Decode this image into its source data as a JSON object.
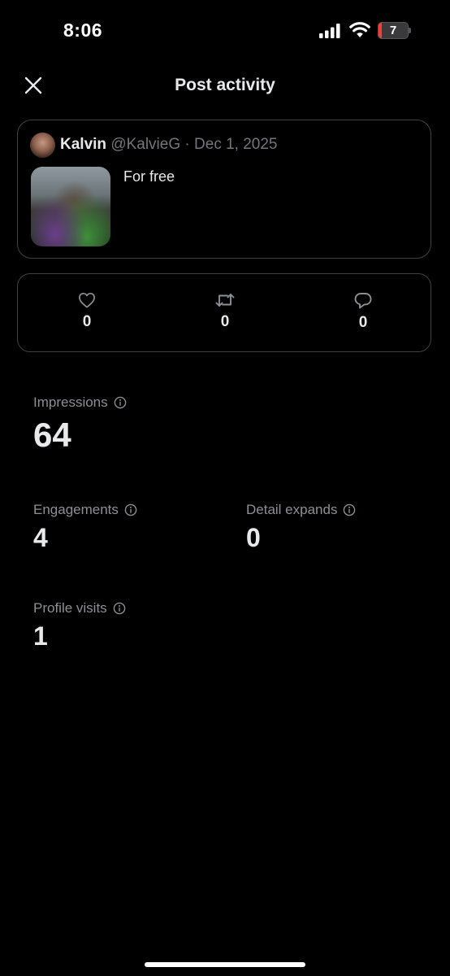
{
  "status_bar": {
    "time": "8:06",
    "battery_level": "7",
    "battery_fraction": 0.07
  },
  "header": {
    "title": "Post activity",
    "close_icon": "close-icon"
  },
  "post": {
    "author_name": "Kalvin",
    "handle": "@KalvieG",
    "separator": "·",
    "date": "Dec 1, 2025",
    "text": "For free"
  },
  "interactions": {
    "likes": "0",
    "reposts": "0",
    "replies": "0",
    "icons": [
      "heart-icon",
      "repost-icon",
      "reply-icon"
    ]
  },
  "stats": {
    "impressions": {
      "label": "Impressions",
      "value": "64"
    },
    "engagements": {
      "label": "Engagements",
      "value": "4"
    },
    "detail_expands": {
      "label": "Detail expands",
      "value": "0"
    },
    "profile_visits": {
      "label": "Profile visits",
      "value": "1"
    }
  },
  "colors": {
    "background": "#000000",
    "text_primary": "#e7e9ea",
    "text_secondary": "#71767b",
    "border": "#3e4144",
    "battery_low": "#ff3b30"
  }
}
